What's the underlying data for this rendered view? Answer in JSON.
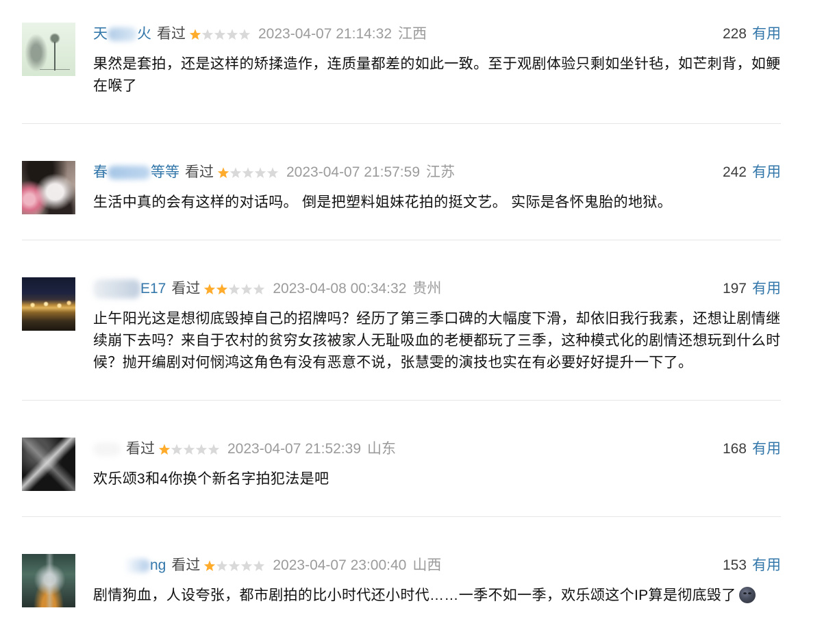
{
  "colors": {
    "link": "#3377aa",
    "star_filled": "#ffac2d",
    "star_empty": "#d9d9d9",
    "meta_text": "#9b9b9b"
  },
  "reviews": [
    {
      "user": {
        "prefix": "天",
        "suffix": "火"
      },
      "status": "看过",
      "rating": 1,
      "rating_max": 5,
      "time": "2023-04-07 21:14:32",
      "location": "江西",
      "useful_count": 228,
      "useful_label": "有用",
      "text": "果然是套拍，还是这样的矫揉造作，连质量都差的如此一致。至于观剧体验只剩如坐针毡，如芒刺背，如鲠在喉了"
    },
    {
      "user": {
        "prefix": "春",
        "suffix": "等等"
      },
      "status": "看过",
      "rating": 1,
      "rating_max": 5,
      "time": "2023-04-07 21:57:59",
      "location": "江苏",
      "useful_count": 242,
      "useful_label": "有用",
      "text": "生活中真的会有这样的对话吗。 倒是把塑料姐妹花拍的挺文艺。 实际是各怀鬼胎的地狱。"
    },
    {
      "user": {
        "suffix": "E17"
      },
      "status": "看过",
      "rating": 2,
      "rating_max": 5,
      "time": "2023-04-08 00:34:32",
      "location": "贵州",
      "useful_count": 197,
      "useful_label": "有用",
      "text": "止午阳光这是想彻底毁掉自己的招牌吗？经历了第三季口碑的大幅度下滑，却依旧我行我素，还想让剧情继续崩下去吗？来自于农村的贫穷女孩被家人无耻吸血的老梗都玩了三季，这种模式化的剧情还想玩到什么时候？抛开编剧对何悯鸿这角色有没有恶意不说，张慧雯的演技也实在有必要好好提升一下了。"
    },
    {
      "user": {},
      "status": "看过",
      "rating": 1,
      "rating_max": 5,
      "time": "2023-04-07 21:52:39",
      "location": "山东",
      "useful_count": 168,
      "useful_label": "有用",
      "text": "欢乐颂3和4你换个新名字拍犯法是吧"
    },
    {
      "user": {
        "suffix": "ng"
      },
      "status": "看过",
      "rating": 1,
      "rating_max": 5,
      "time": "2023-04-07 23:00:40",
      "location": "山西",
      "useful_count": 153,
      "useful_label": "有用",
      "text": "剧情狗血，人设夸张，都市剧拍的比小时代还小时代……一季不如一季，欢乐颂这个IP算是彻底毁了",
      "emoji": "new-moon-face"
    }
  ]
}
